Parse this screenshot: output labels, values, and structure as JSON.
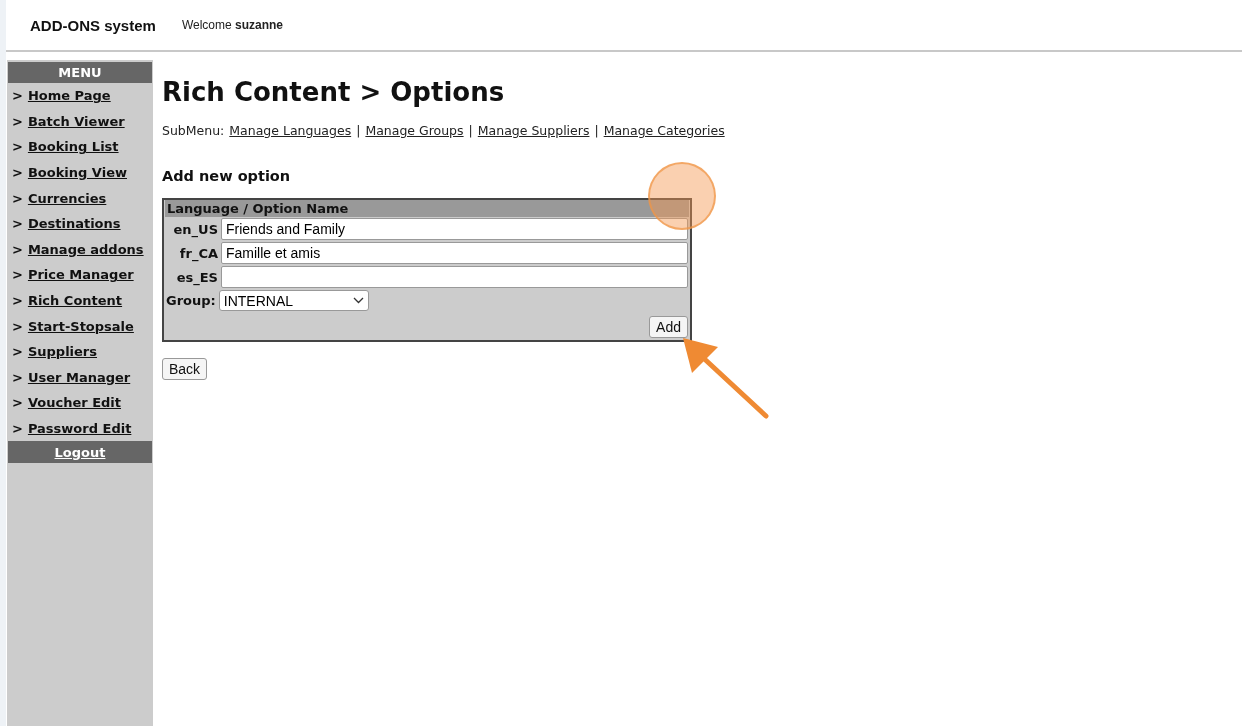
{
  "header": {
    "app_name": "ADD-ONS system",
    "welcome": "Welcome **suzanne**"
  },
  "menu": {
    "title": "MENU",
    "items": [
      {
        "prefix": ">",
        "label": "Home Page"
      },
      {
        "prefix": ">",
        "label": "Batch Viewer"
      },
      {
        "prefix": ">",
        "label": "Booking List"
      },
      {
        "prefix": ">",
        "label": "Booking View"
      },
      {
        "prefix": ">",
        "label": "Currencies"
      },
      {
        "prefix": ">",
        "label": "Destinations"
      },
      {
        "prefix": ">",
        "label": "Manage addons"
      },
      {
        "prefix": ">",
        "label": "Price Manager"
      },
      {
        "prefix": ">",
        "label": "Rich Content"
      },
      {
        "prefix": ">",
        "label": "Start-Stopsale"
      },
      {
        "prefix": ">",
        "label": "Suppliers"
      },
      {
        "prefix": ">",
        "label": "User Manager"
      },
      {
        "prefix": ">",
        "label": "Voucher Edit"
      },
      {
        "prefix": ">",
        "label": "Password Edit"
      }
    ],
    "logout": "Logout"
  },
  "page_title": "Rich Content > Options",
  "submenu": {
    "label": "SubMenu:",
    "separator": "|",
    "links": [
      "Manage Languages",
      "Manage Groups",
      "Manage Suppliers",
      "Manage Categories"
    ]
  },
  "section_title": "Add new option",
  "form": {
    "header": "Language / Option Name",
    "rows": [
      {
        "language": "en_US",
        "value": "Friends and Family"
      },
      {
        "language": "fr_CA",
        "value": "Famille et amis"
      },
      {
        "language": "es_ES",
        "value": ""
      }
    ],
    "group_label": "Group:",
    "group_value": "INTERNAL",
    "add_button": "Add"
  },
  "back_button": "Back"
}
